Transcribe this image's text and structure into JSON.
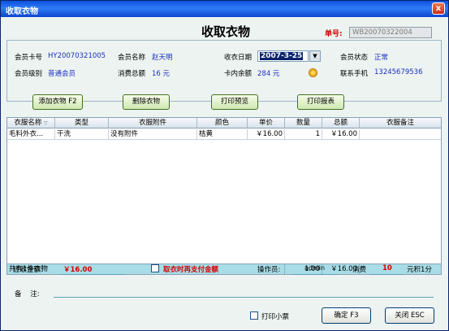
{
  "window": {
    "title": "收取衣物",
    "close_glyph": "x"
  },
  "form": {
    "title": "收取衣物",
    "order_label": "单号:",
    "order_value": "WB20070322004"
  },
  "member": {
    "card_label": "会员卡号",
    "card_value": "HY20070321005",
    "name_label": "会员名称",
    "name_value": "赵天明",
    "date_label": "收衣日期",
    "date_value": "2007-3-25",
    "status_label": "会员状态",
    "status_value": "正常",
    "level_label": "会员级别",
    "level_value": "普通会员",
    "spend_label": "消费总额",
    "spend_value": "16 元",
    "balance_label": "卡内余额",
    "balance_value": "284 元",
    "phone_label": "联系手机",
    "phone_value": "13245679536"
  },
  "toolbar": {
    "add": "添加衣物 F2",
    "delete": "删除衣物",
    "preview": "打印预览",
    "report": "打印报表"
  },
  "grid": {
    "columns": [
      "衣服名称",
      "类型",
      "衣服附件",
      "颜色",
      "单价",
      "数量",
      "总额",
      "衣服备注"
    ],
    "rows": [
      {
        "name": "毛料外衣...",
        "type": "干洗",
        "accessory": "没有附件",
        "color": "桔黄",
        "price": "￥16.00",
        "qty": "1",
        "total": "￥16.00",
        "remark": ""
      }
    ],
    "footer": {
      "summary": "共有1件衣物",
      "qty_total": "1.00",
      "amount_total": "￥16.00"
    }
  },
  "payment": {
    "receivable_label": "应收金额:",
    "receivable_value": "￥16.00",
    "pay_on_pickup_label": "取衣时再支付金额",
    "operator_label": "操作员:",
    "operator_value": "admin",
    "consume_label": "消费",
    "consume_value": "10",
    "points_label": "元积1分",
    "remark_label": "备    注:",
    "remark_value": ""
  },
  "bottom": {
    "print_ticket_label": "打印小票",
    "ok": "确定 F3",
    "close": "关闭 ESC"
  }
}
